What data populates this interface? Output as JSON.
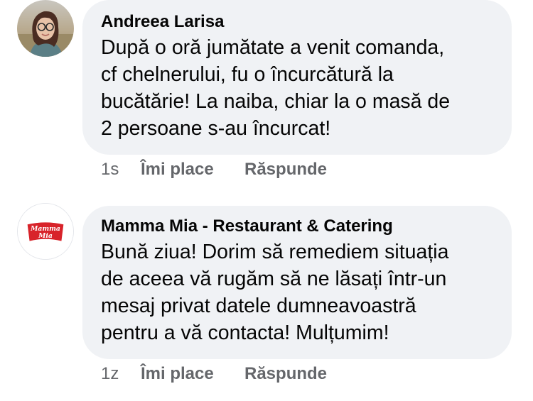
{
  "comments": [
    {
      "author": "Andreea Larisa",
      "text": "După o oră jumătate a venit comanda,\ncf chelnerului, fu o încurcătură la\nbucătărie! La naiba, chiar la o masă de\n2 persoane s-au încurcat!",
      "time": "1s",
      "like_label": "Îmi place",
      "reply_label": "Răspunde"
    },
    {
      "author": "Mamma Mia - Restaurant & Catering",
      "avatar_logo_text": "Mamma Mia",
      "text": "Bună ziua! Dorim să remediem situația\nde aceea vă rugăm să ne lăsați într-un\nmesaj privat datele dumneavoastră\npentru a vă contacta! Mulțumim!",
      "time": "1z",
      "like_label": "Îmi place",
      "reply_label": "Răspunde"
    }
  ],
  "colors": {
    "bubble": "#f0f2f5",
    "text": "#050505",
    "meta": "#65676b",
    "brand_red": "#d8232a"
  }
}
